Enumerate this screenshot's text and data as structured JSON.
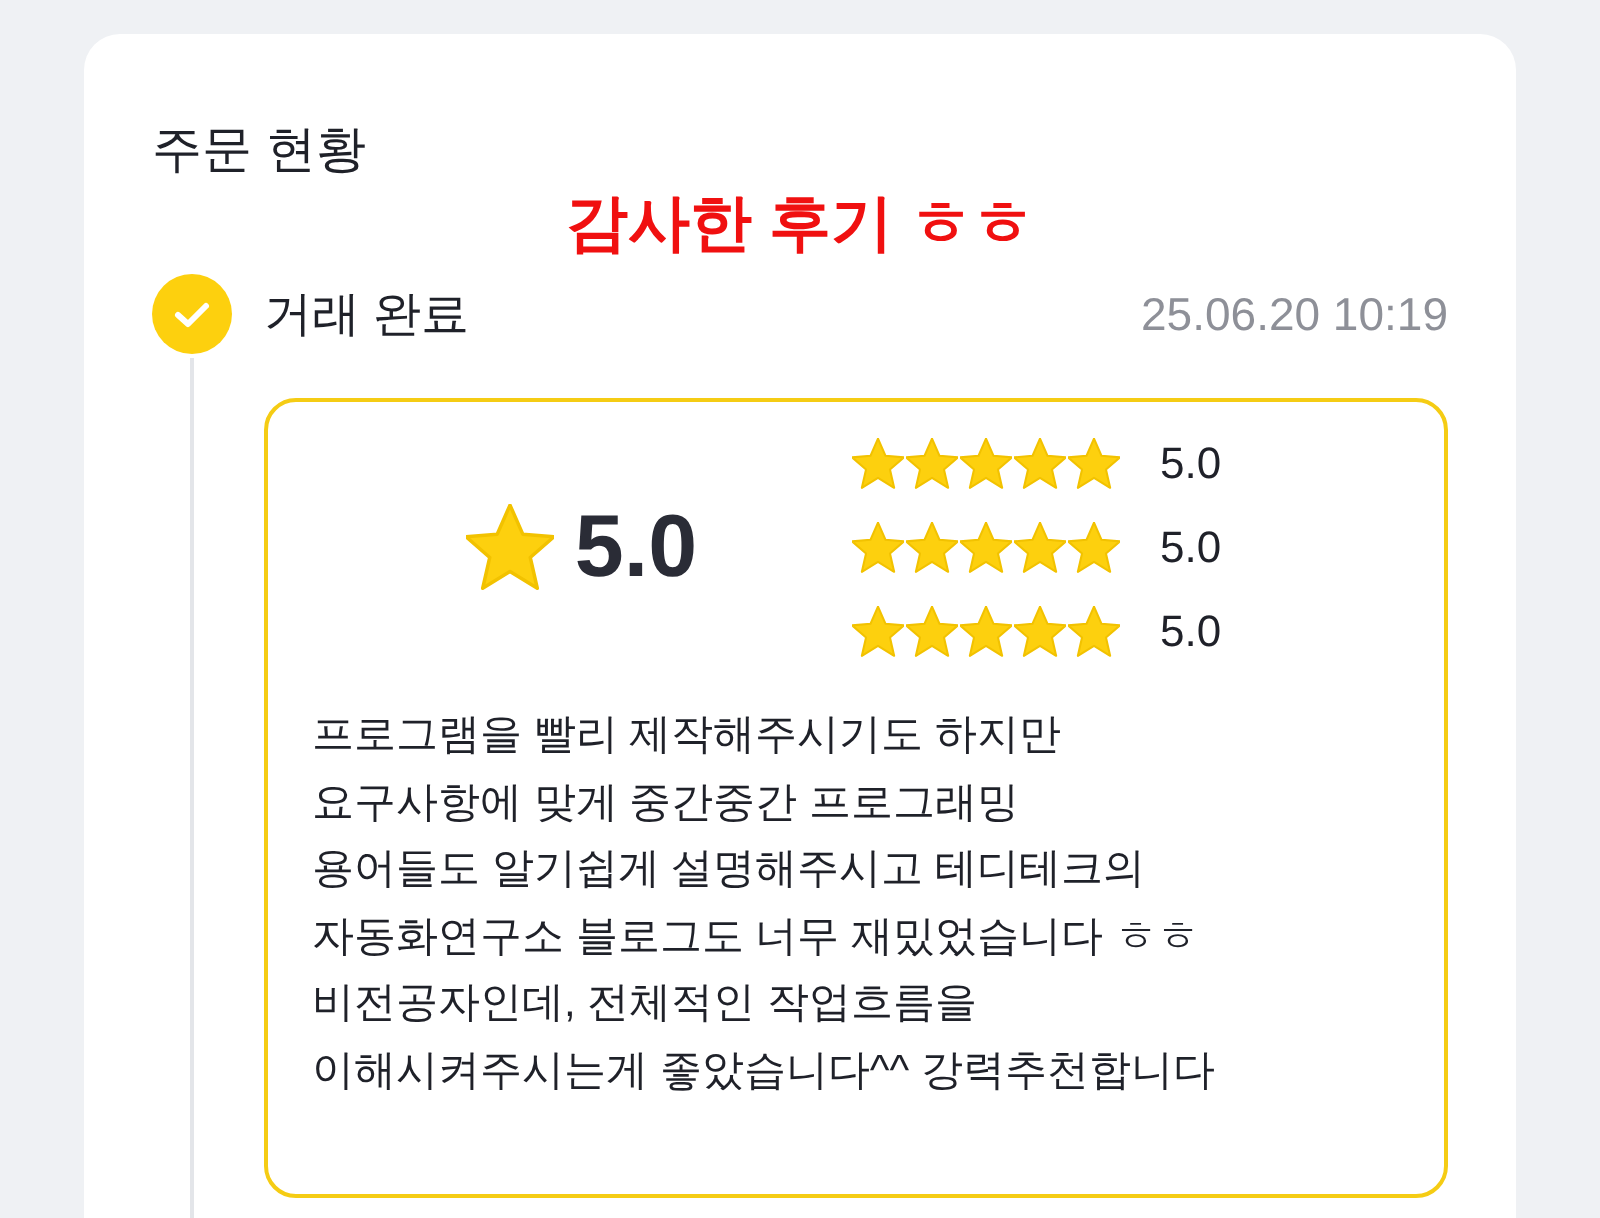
{
  "title": "주문 현황",
  "banner": "감사한 후기 ㅎㅎ",
  "step": {
    "label": "거래 완료",
    "time": "25.06.20 10:19",
    "done": true
  },
  "review": {
    "score": "5.0",
    "ratings": [
      {
        "stars": 5,
        "reading": "5.0"
      },
      {
        "stars": 5,
        "reading": "5.0"
      },
      {
        "stars": 5,
        "reading": "5.0"
      }
    ],
    "text": "프로그램을 빨리 제작해주시기도 하지만\n요구사항에 맞게 중간중간 프로그래밍\n용어들도 알기쉽게 설명해주시고 테디테크의\n자동화연구소 블로그도 너무 재밌었습니다 ㅎㅎ\n비전공자인데, 전체적인 작업흐름을\n이해시켜주시는게 좋았습니다^^ 강력추천합니다"
  }
}
